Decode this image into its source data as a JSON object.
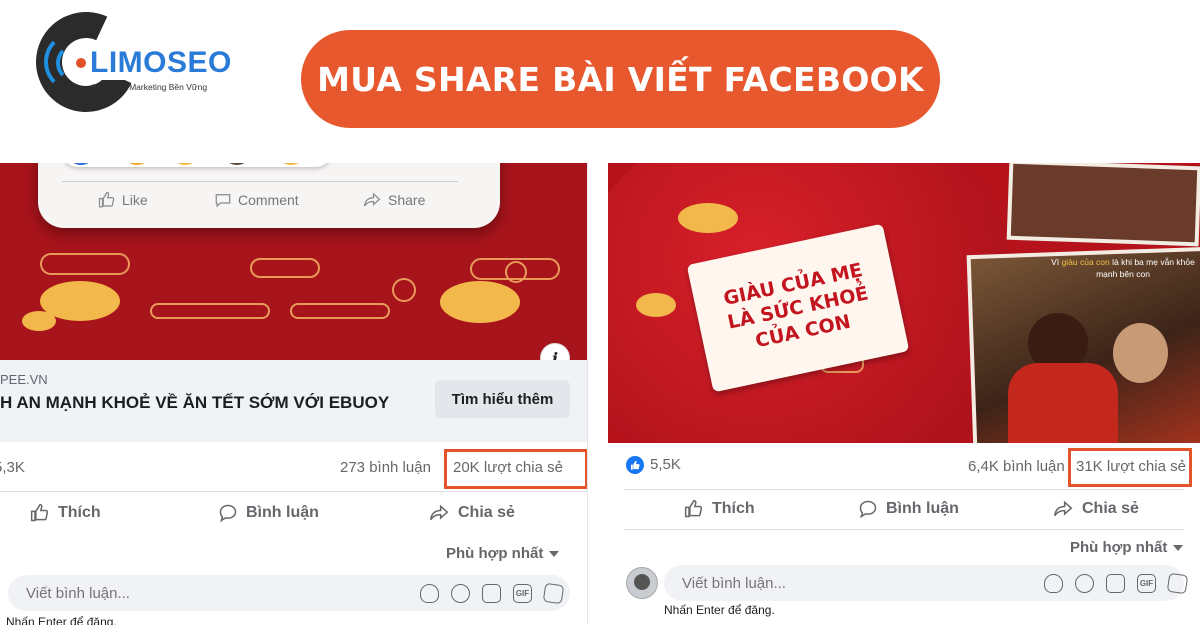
{
  "logo": {
    "name": "LIMOSEO",
    "tagline": "Khởi Tạo Marketing Bền Vững"
  },
  "banner": {
    "title": "MUA SHARE BÀI VIẾT FACEBOOK"
  },
  "colors": {
    "accent": "#e8582e",
    "highlight_border": "#e5532b",
    "facebook_blue": "#1877f2"
  },
  "left_post": {
    "image": {
      "mock_actions": [
        "Like",
        "Comment",
        "Share"
      ],
      "info_icon": "info-icon"
    },
    "ad": {
      "domain": "PEE.VN",
      "title": "H AN MẠNH KHOẺ VỀ ĂN TẾT SỚM VỚI EBUOY",
      "cta": "Tìm hiểu thêm"
    },
    "stats": {
      "reactions": "5,3K",
      "comments": "273 bình luận",
      "shares": "20K lượt chia sẻ"
    },
    "actions": [
      {
        "label": "Thích",
        "icon": "thumbs-up-icon"
      },
      {
        "label": "Bình luận",
        "icon": "comment-icon"
      },
      {
        "label": "Chia sẻ",
        "icon": "share-icon"
      }
    ],
    "sort": "Phù hợp nhất",
    "comment": {
      "placeholder": "Viết bình luận...",
      "hint": "Nhấn Enter để đăng."
    }
  },
  "right_post": {
    "image": {
      "label_lines": [
        "GIÀU CỦA MẸ",
        "LÀ SỨC KHOẺ",
        "CỦA CON"
      ],
      "caption_pre": "Vì ",
      "caption_highlight": "giàu của con",
      "caption_post": " là khi ba mẹ vẫn khỏe mạnh bên con"
    },
    "stats": {
      "reactions": "5,5K",
      "comments": "6,4K bình luận",
      "shares": "31K lượt chia sẻ"
    },
    "actions": [
      {
        "label": "Thích",
        "icon": "thumbs-up-icon"
      },
      {
        "label": "Bình luận",
        "icon": "comment-icon"
      },
      {
        "label": "Chia sẻ",
        "icon": "share-icon"
      }
    ],
    "sort": "Phù hợp nhất",
    "comment": {
      "placeholder": "Viết bình luận...",
      "hint": "Nhấn Enter để đăng."
    }
  },
  "comment_tools": [
    "sticker-icon",
    "emoji-icon",
    "camera-icon",
    "gif-icon",
    "sticker-2-icon"
  ],
  "gif_label": "GIF"
}
